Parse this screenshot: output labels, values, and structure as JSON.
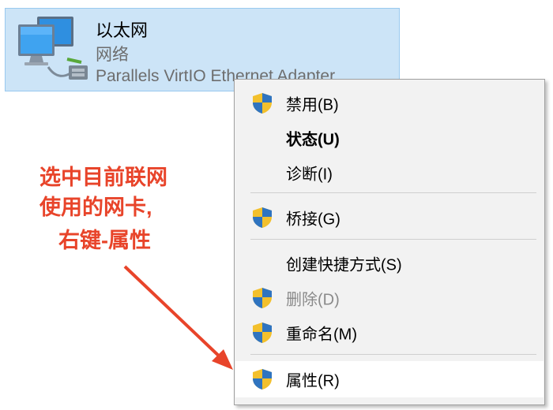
{
  "adapter": {
    "name": "以太网",
    "network": "网络",
    "description": "Parallels VirtIO Ethernet Adapter",
    "icon": "network-adapter-icon"
  },
  "menu": {
    "items": [
      {
        "label": "禁用(B)",
        "icon": "uac-shield-icon"
      },
      {
        "label": "状态(U)"
      },
      {
        "label": "诊断(I)"
      },
      {
        "label": "桥接(G)",
        "icon": "uac-shield-icon"
      },
      {
        "label": "创建快捷方式(S)"
      },
      {
        "label": "删除(D)",
        "icon": "uac-shield-icon",
        "disabled": true
      },
      {
        "label": "重命名(M)",
        "icon": "uac-shield-icon"
      },
      {
        "label": "属性(R)",
        "icon": "uac-shield-icon",
        "highlighted": true
      }
    ]
  },
  "annotation": {
    "line1": "选中目前联网",
    "line2": "使用的网卡,",
    "line3": "右键-属性",
    "color": "#e8442a"
  },
  "colors": {
    "selection_bg": "#cce4f7",
    "menu_bg": "#f2f2f2"
  }
}
